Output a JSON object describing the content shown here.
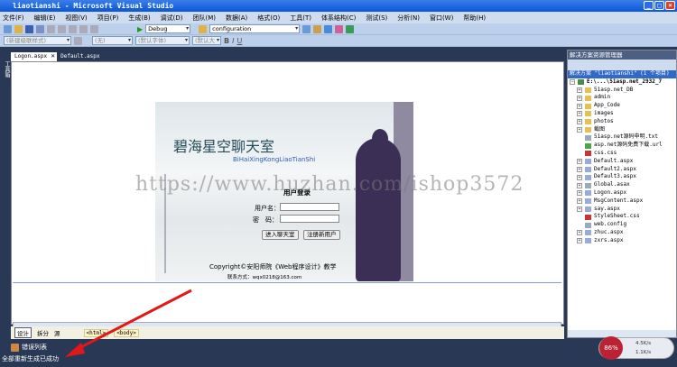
{
  "window": {
    "title": "liaotianshi - Microsoft Visual Studio"
  },
  "menu": [
    "文件(F)",
    "编辑(E)",
    "视图(V)",
    "项目(P)",
    "生成(B)",
    "调试(D)",
    "团队(M)",
    "数据(A)",
    "格式(O)",
    "工具(T)",
    "体系结构(C)",
    "测试(S)",
    "分析(N)",
    "窗口(W)",
    "帮助(H)"
  ],
  "toolbar": {
    "config": "Debug",
    "platform": "configuration",
    "style": "(新建级联样式)",
    "none": "(无)",
    "font": "(默认字体)",
    "size": "(默认大",
    "bold": "B",
    "italic": "I",
    "underline": "U"
  },
  "tabs": [
    "Logon.aspx",
    "Default.aspx"
  ],
  "toolbox": "工具箱",
  "login": {
    "title": "碧海星空聊天室",
    "subtitle": "BiHaiXingKongLiaoTianShi",
    "heading": "用户登录",
    "user_label": "用户名：",
    "pwd_label": "密　码：",
    "enter_button": "进入聊天室",
    "register_button": "注册新用户",
    "copyright": "Copyright©安阳师院《Web程序设计》教学",
    "contact": "联系方式：wqx0218@163.com"
  },
  "watermark": "https://www.huzhan.com/ishop3572",
  "viewbar": {
    "design": "设计",
    "split": "拆分",
    "source": "源",
    "tag1": "<html>",
    "tag2": "<body>"
  },
  "solution": {
    "title": "解决方案资源管理器",
    "root": "解决方案 \"liaotianshi\" (1 个项目)",
    "project": "E:\\...\\51asp.net_2932_7",
    "items": [
      {
        "name": "51asp.net_DB",
        "type": "folder"
      },
      {
        "name": "admin",
        "type": "folder"
      },
      {
        "name": "App_Code",
        "type": "folder"
      },
      {
        "name": "images",
        "type": "folder"
      },
      {
        "name": "photos",
        "type": "folder"
      },
      {
        "name": "截图",
        "type": "folder"
      },
      {
        "name": "51asp.net源码申明.txt",
        "type": "file"
      },
      {
        "name": "asp.net源码免费下载.url",
        "type": "url"
      },
      {
        "name": "css.css",
        "type": "css"
      },
      {
        "name": "Default.aspx",
        "type": "page"
      },
      {
        "name": "Default2.aspx",
        "type": "page"
      },
      {
        "name": "Default3.aspx",
        "type": "page"
      },
      {
        "name": "Global.asax",
        "type": "file"
      },
      {
        "name": "Logon.aspx",
        "type": "page"
      },
      {
        "name": "MsgContent.aspx",
        "type": "page"
      },
      {
        "name": "say.aspx",
        "type": "page"
      },
      {
        "name": "StyleSheet.css",
        "type": "css"
      },
      {
        "name": "web.config",
        "type": "file"
      },
      {
        "name": "zhuc.aspx",
        "type": "page"
      },
      {
        "name": "zxrs.aspx",
        "type": "page"
      }
    ]
  },
  "errorlist": "错误列表",
  "status": "全部重新生成已成功",
  "gauge": {
    "cpu": "86%",
    "up": "4.5K/s",
    "down": "1.1K/s"
  }
}
